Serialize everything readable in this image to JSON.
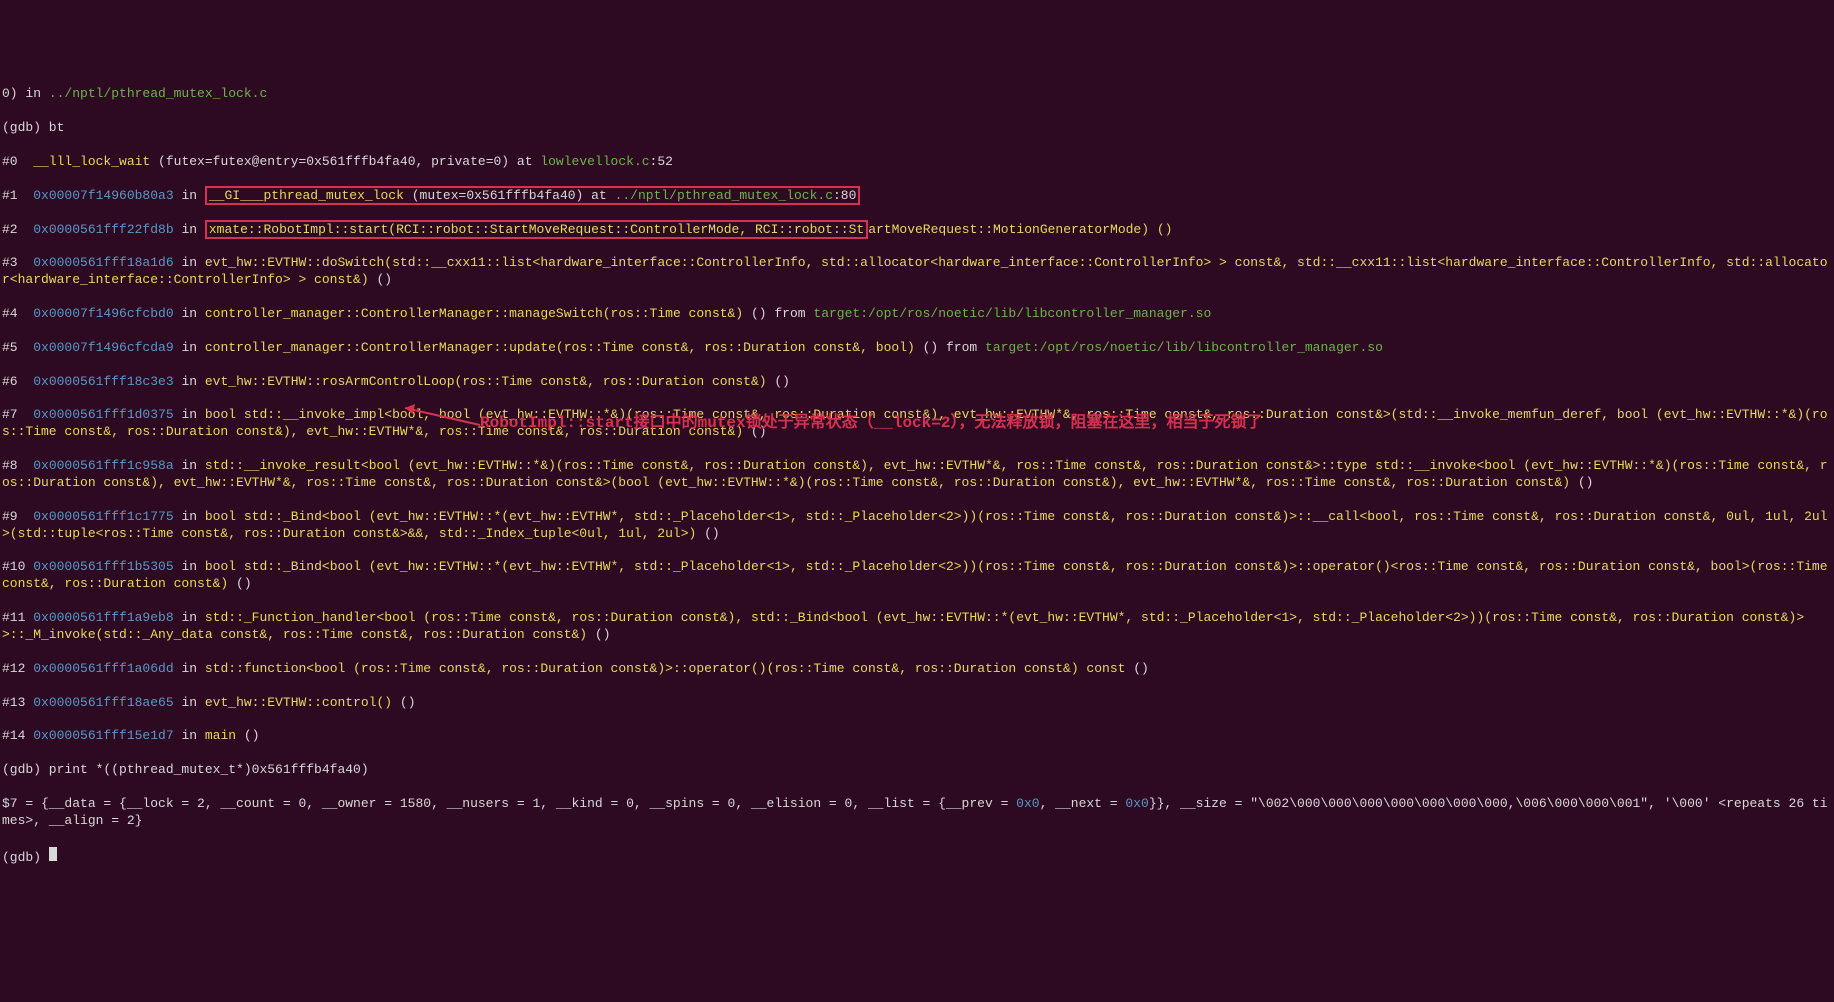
{
  "lines": {
    "l0_prefix": "0) in ",
    "l0_path": "../nptl/pthread_mutex_lock.c",
    "l1_cmd": "(gdb) bt",
    "l2_idx": "#0  ",
    "l2_fn": "__lll_lock_wait",
    "l2_args": " (futex=futex@entry=0x561fffb4fa40, private=0) at ",
    "l2_file": "lowlevellock.c",
    "l2_line": ":52",
    "l3_idx": "#1  ",
    "l3_addr": "0x00007f14960b80a3",
    "l3_in": " in ",
    "l3_box_fn": "__GI___pthread_mutex_lock",
    "l3_box_args": " (mutex=0x561fffb4fa40) at ",
    "l3_box_file": "../nptl/pthread_mutex_lock.c",
    "l3_box_line": ":80",
    "l4_idx": "#2  ",
    "l4_addr": "0x0000561fff22fd8b",
    "l4_in": " in ",
    "l4_box": "xmate::RobotImpl::start(RCI::robot::StartMoveRequest::ControllerMode, RCI::robot::St",
    "l4_rest": "artMoveRequest::MotionGeneratorMode) ()",
    "l5_idx": "#3  ",
    "l5_addr": "0x0000561fff18a1d6",
    "l5_in": " in ",
    "l5_fn": "evt_hw::EVTHW::doSwitch(std::__cxx11::list<hardware_interface::ControllerInfo, std::allocator<hardware_interface::ControllerInfo> > const&, std::__cxx11::list<hardware_interface::ControllerInfo, std::allocator<hardware_interface::ControllerInfo> > const&)",
    "l5_end": " ()",
    "l6_idx": "#4  ",
    "l6_addr": "0x00007f1496cfcbd0",
    "l6_in": " in ",
    "l6_fn": "controller_manager::ControllerManager::manageSwitch(ros::Time const&)",
    "l6_from": " () from ",
    "l6_path": "target:/opt/ros/noetic/lib/libcontroller_manager.so",
    "l7_idx": "#5  ",
    "l7_addr": "0x00007f1496cfcda9",
    "l7_in": " in ",
    "l7_fn": "controller_manager::ControllerManager::update(ros::Time const&, ros::Duration const&, bool)",
    "l7_from": " () from ",
    "l7_path": "target:/opt/ros/noetic/lib/libcontroller_manager.so",
    "l8_idx": "#6  ",
    "l8_addr": "0x0000561fff18c3e3",
    "l8_in": " in ",
    "l8_fn": "evt_hw::EVTHW::rosArmControlLoop(ros::Time const&, ros::Duration const&)",
    "l8_end": " ()",
    "l9_idx": "#7  ",
    "l9_addr": "0x0000561fff1d0375",
    "l9_in": " in ",
    "l9_fn": "bool std::__invoke_impl<bool, bool (evt_hw::EVTHW::*&)(ros::Time const&, ros::Duration const&), evt_hw::EVTHW*&, ros::Time const&, ros::Duration const&>(std::__invoke_memfun_deref, bool (evt_hw::EVTHW::*&)(ros::Time const&, ros::Duration const&), evt_hw::EVTHW*&, ros::Time const&, ros::Duration const&)",
    "l9_end": " ()",
    "l10_idx": "#8  ",
    "l10_addr": "0x0000561fff1c958a",
    "l10_in": " in ",
    "l10_fn": "std::__invoke_result<bool (evt_hw::EVTHW::*&)(ros::Time const&, ros::Duration const&), evt_hw::EVTHW*&, ros::Time const&, ros::Duration const&>::type std::__invoke<bool (evt_hw::EVTHW::*&)(ros::Time const&, ros::Duration const&), evt_hw::EVTHW*&, ros::Time const&, ros::Duration const&>(bool (evt_hw::EVTHW::*&)(ros::Time const&, ros::Duration const&), evt_hw::EVTHW*&, ros::Time const&, ros::Duration const&)",
    "l10_end": " ()",
    "l11_idx": "#9  ",
    "l11_addr": "0x0000561fff1c1775",
    "l11_in": " in ",
    "l11_fn": "bool std::_Bind<bool (evt_hw::EVTHW::*(evt_hw::EVTHW*, std::_Placeholder<1>, std::_Placeholder<2>))(ros::Time const&, ros::Duration const&)>::__call<bool, ros::Time const&, ros::Duration const&, 0ul, 1ul, 2ul>(std::tuple<ros::Time const&, ros::Duration const&>&&, std::_Index_tuple<0ul, 1ul, 2ul>)",
    "l11_end": " ()",
    "l12_idx": "#10 ",
    "l12_addr": "0x0000561fff1b5305",
    "l12_in": " in ",
    "l12_fn": "bool std::_Bind<bool (evt_hw::EVTHW::*(evt_hw::EVTHW*, std::_Placeholder<1>, std::_Placeholder<2>))(ros::Time const&, ros::Duration const&)>::operator()<ros::Time const&, ros::Duration const&, bool>(ros::Time const&, ros::Duration const&)",
    "l12_end": " ()",
    "l13_idx": "#11 ",
    "l13_addr": "0x0000561fff1a9eb8",
    "l13_in": " in ",
    "l13_fn": "std::_Function_handler<bool (ros::Time const&, ros::Duration const&), std::_Bind<bool (evt_hw::EVTHW::*(evt_hw::EVTHW*, std::_Placeholder<1>, std::_Placeholder<2>))(ros::Time const&, ros::Duration const&)> >::_M_invoke(std::_Any_data const&, ros::Time const&, ros::Duration const&)",
    "l13_end": " ()",
    "l14_idx": "#12 ",
    "l14_addr": "0x0000561fff1a06dd",
    "l14_in": " in ",
    "l14_fn": "std::function<bool (ros::Time const&, ros::Duration const&)>::operator()(ros::Time const&, ros::Duration const&) const",
    "l14_end": " ()",
    "l15_idx": "#13 ",
    "l15_addr": "0x0000561fff18ae65",
    "l15_in": " in ",
    "l15_fn": "evt_hw::EVTHW::control()",
    "l15_end": " ()",
    "l16_idx": "#14 ",
    "l16_addr": "0x0000561fff15e1d7",
    "l16_in": " in ",
    "l16_fn": "main",
    "l16_end": " ()",
    "l17": "(gdb) print *((pthread_mutex_t*)0x561fffb4fa40)",
    "l18_pre": "$7 = {__data = {__lock = 2, __count = 0, __owner = 1580, __nusers = 1, __kind = 0, __spins = 0, __elision = 0, __list = {__prev = ",
    "l18_addr1": "0x0",
    "l18_mid": ", __next = ",
    "l18_addr2": "0x0",
    "l18_after": "}}, __size = \"\\002\\000\\000\\000\\000\\000\\000\\000,\\006\\000\\000\\001\", '\\000' <repeats 26 times>, __align = 2}",
    "l19": "(gdb) "
  },
  "annotation": "RobotImpl::start接口中的mutex锁处于异常状态（__lock=2），无法释放锁，阻塞在这里，相当于死锁了"
}
